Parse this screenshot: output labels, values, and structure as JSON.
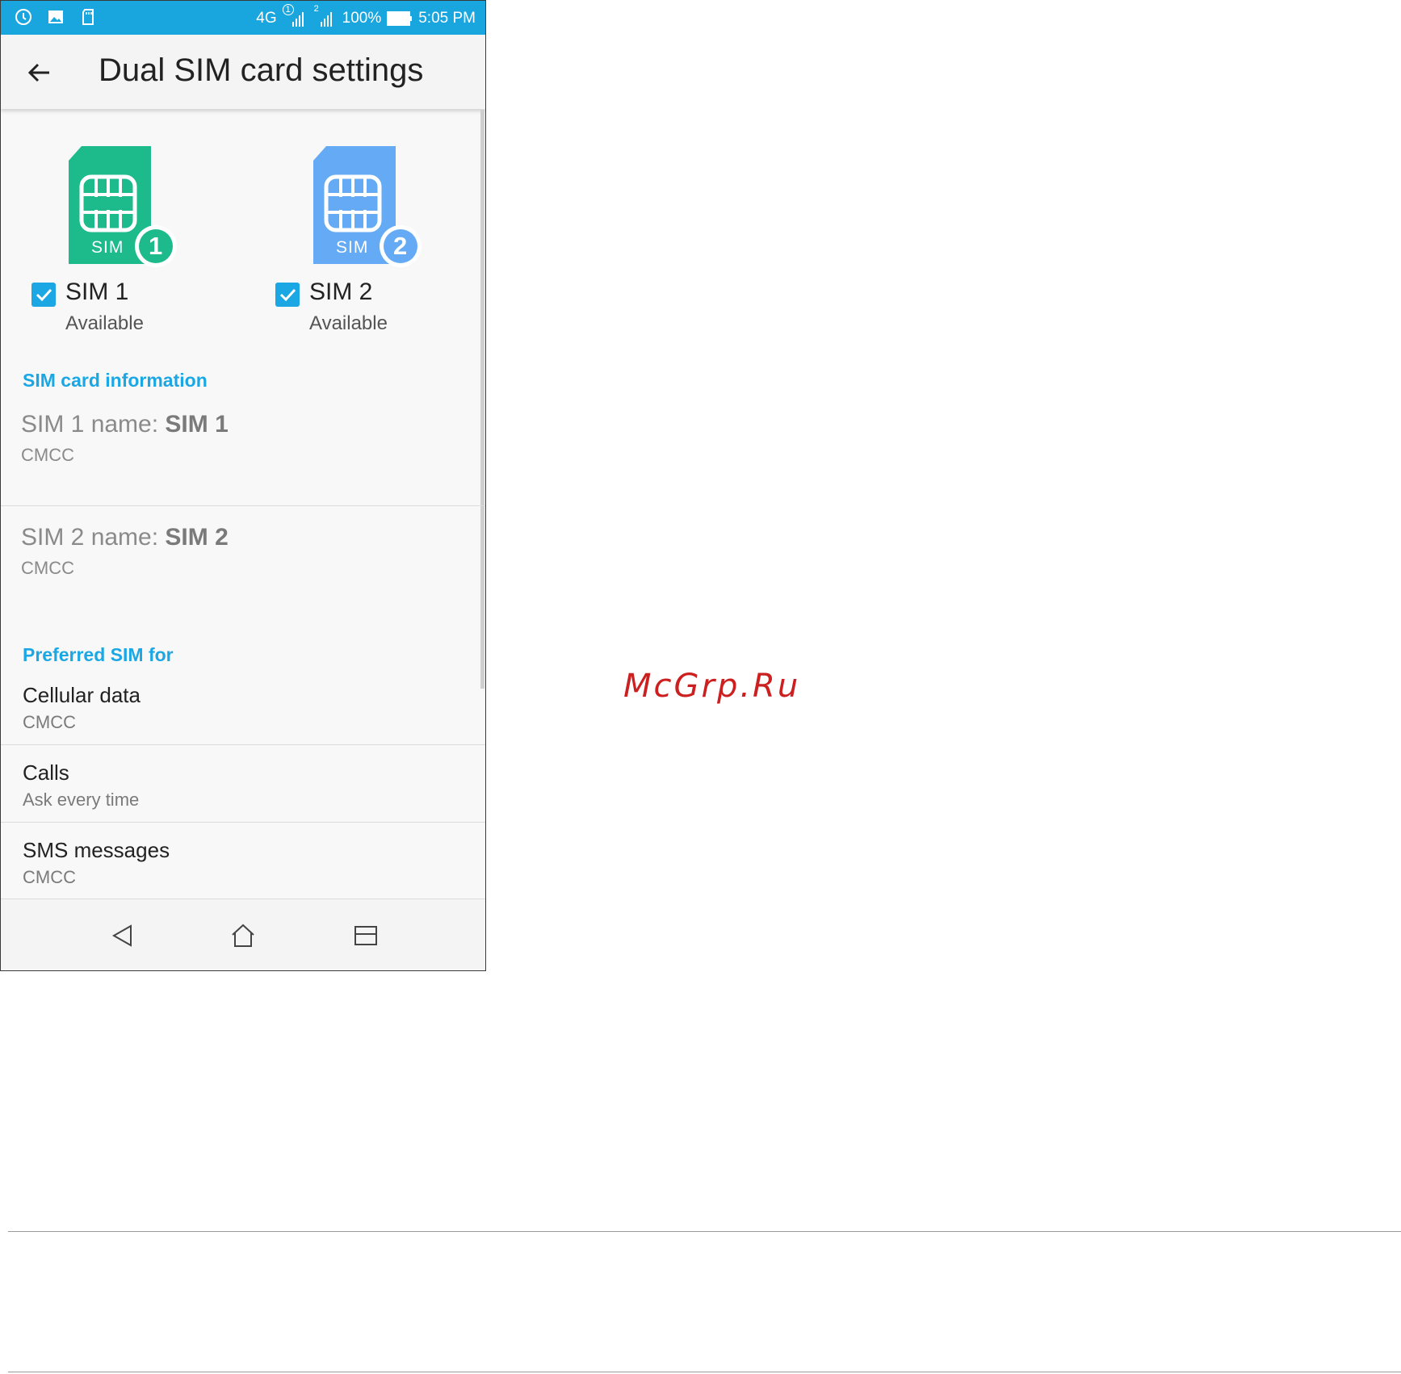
{
  "status_bar": {
    "network": "4G",
    "sim1_badge": "1",
    "sim2_badge": "2",
    "battery": "100%",
    "time": "5:05 PM"
  },
  "app_bar": {
    "title": "Dual SIM card settings"
  },
  "sims": [
    {
      "card_label": "SIM",
      "badge": "1",
      "title": "SIM 1",
      "status": "Available",
      "checked": true,
      "color": "#1dba8c"
    },
    {
      "card_label": "SIM",
      "badge": "2",
      "title": "SIM 2",
      "status": "Available",
      "checked": true,
      "color": "#64aaf5"
    }
  ],
  "sim_info": {
    "header": "SIM card information",
    "items": [
      {
        "label": "SIM 1 name: ",
        "value": "SIM 1",
        "carrier": "CMCC"
      },
      {
        "label": "SIM 2 name: ",
        "value": "SIM 2",
        "carrier": "CMCC"
      }
    ]
  },
  "preferred": {
    "header": "Preferred SIM for",
    "items": [
      {
        "title": "Cellular data",
        "value": "CMCC"
      },
      {
        "title": "Calls",
        "value": "Ask every time"
      },
      {
        "title": "SMS messages",
        "value": "CMCC"
      }
    ]
  },
  "watermark": "McGrp.Ru",
  "colors": {
    "accent": "#1aa7e4",
    "status_bar": "#19a5dd"
  }
}
